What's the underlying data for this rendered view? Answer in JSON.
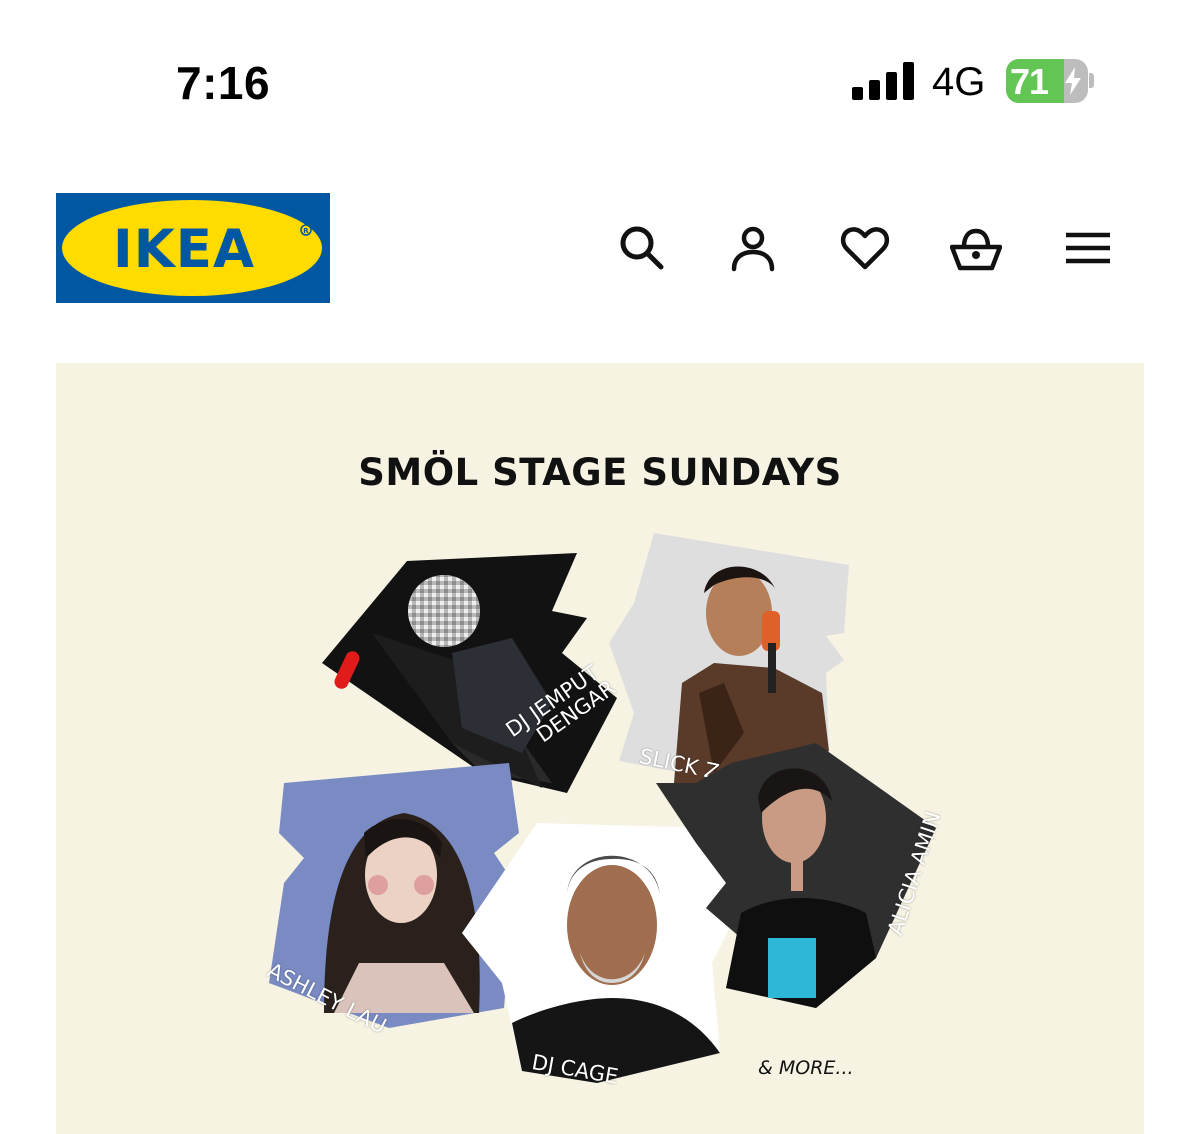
{
  "status_bar": {
    "time": "7:16",
    "network": "4G",
    "battery": "71",
    "battery_level": 0.71
  },
  "header": {
    "logo_text": "IKEA",
    "icons": [
      "search-icon",
      "account-icon",
      "heart-icon",
      "basket-icon",
      "menu-icon"
    ]
  },
  "banner": {
    "title": "SMÖL STAGE SUNDAYS",
    "performers": [
      {
        "line1": "DJ JEMPUT",
        "line2": "DENGAR"
      },
      {
        "line1": "SLICK Z"
      },
      {
        "line1": "ASHLEY LAU"
      },
      {
        "line1": "DJ CAGE"
      },
      {
        "line1": "ALICIA AMIN"
      }
    ],
    "more": "& MORE..."
  },
  "colors": {
    "ikea_blue": "#0058a3",
    "ikea_yellow": "#ffdb00",
    "banner_bg": "#f6f3e3",
    "battery_green": "#62c554"
  }
}
